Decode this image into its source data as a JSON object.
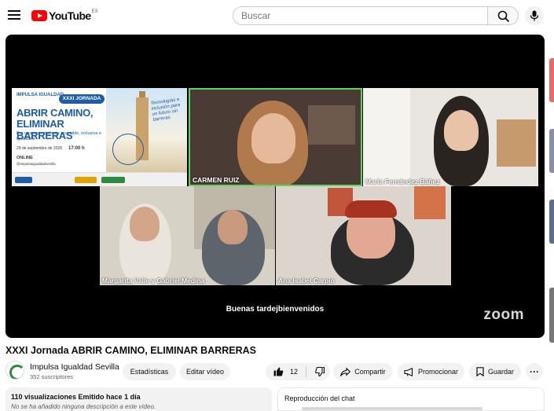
{
  "header": {
    "logo_text": "YouTube",
    "country_code": "ES",
    "search_placeholder": "Buscar",
    "icons": [
      "menu-icon",
      "search-icon",
      "mic-icon"
    ]
  },
  "player": {
    "banner": {
      "org": "IMPULSA IGUALDAD",
      "jornada": "XXXI JORNADA",
      "title_line1": "ABRIR CAMINO,",
      "title_line2": "ELIMINAR BARRERAS",
      "subtitle": "Por una sociedad más accesible, inclusiva e igualitaria",
      "date": "29 de septiembre de 2026",
      "time": "17:00 h",
      "online": "ONLINE",
      "handle": "@impulsaigualdadsevilla",
      "slogan": "Tecnologías e inclusión para un futuro sin barreras"
    },
    "participants": [
      {
        "name": "CARMEN RUIZ"
      },
      {
        "name": "María Fernández Báñez"
      },
      {
        "name": "Margarita Valle y Gabriel Medina"
      },
      {
        "name": "Ana Isabel Carpio"
      }
    ],
    "caption": "Buenas tardejbienvenidos",
    "watermark": "zoom"
  },
  "video": {
    "title": "XXXI Jornada ABRIR CAMINO, ELIMINAR BARRERAS",
    "channel": "Impulsa Igualdad Sevilla",
    "subscribers": "352 suscriptores",
    "actions": {
      "stats": "Estadísticas",
      "edit": "Editar vídeo",
      "likes": "12",
      "share": "Compartir",
      "promote": "Promocionar",
      "save": "Guardar"
    }
  },
  "description": {
    "stats": "110 visualizaciones  Emitido hace 1 día",
    "text": "No se ha añadido ninguna descripción a este vídeo."
  },
  "chat": {
    "title": "Reproducción del chat"
  },
  "colors": {
    "accent_red": "#ff0000",
    "active_speaker": "#5fd35f",
    "banner_blue": "#1e5ca8"
  }
}
